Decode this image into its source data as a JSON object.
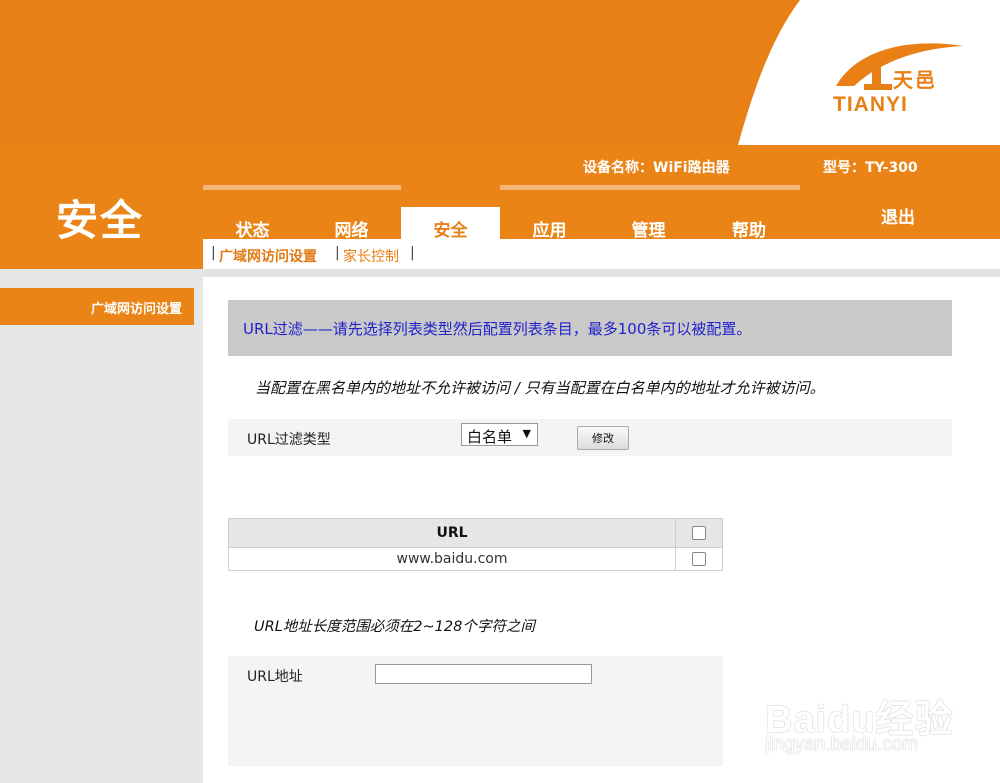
{
  "brand": {
    "logo_cn": "天邑",
    "logo_en": "TIANYI",
    "colors": {
      "primary": "#e88016",
      "white": "#ffffff"
    }
  },
  "header": {
    "section_title": "安全",
    "device_name": "设备名称：WiFi路由器",
    "model": "型号：TY-300",
    "logout": "退出"
  },
  "tabs": [
    {
      "label": "状态",
      "active": false
    },
    {
      "label": "网络",
      "active": false
    },
    {
      "label": "安全",
      "active": true
    },
    {
      "label": "应用",
      "active": false
    },
    {
      "label": "管理",
      "active": false
    },
    {
      "label": "帮助",
      "active": false
    }
  ],
  "subnav": {
    "separator": "|",
    "items": [
      {
        "label": "广域网访问设置",
        "active": true
      },
      {
        "label": "家长控制",
        "active": false
      }
    ]
  },
  "sidebar": {
    "items": [
      {
        "label": "广域网访问设置",
        "active": true
      }
    ]
  },
  "main": {
    "notice": "URL过滤——请先选择列表类型然后配置列表条目，最多100条可以被配置。",
    "description": "当配置在黑名单内的地址不允许被访问 / 只有当配置在白名单内的地址才允许被访问。",
    "filter_type_label": "URL过滤类型",
    "filter_type_value": "白名单",
    "modify_button": "修改",
    "table": {
      "header": "URL",
      "rows": [
        {
          "url": "www.baidu.com",
          "checked": false
        }
      ]
    },
    "length_hint": "URL地址长度范围必须在2~128个字符之间",
    "address_label": "URL地址",
    "address_value": ""
  },
  "watermark": {
    "main": "Baidu经验",
    "sub": "jingyan.baidu.com"
  }
}
